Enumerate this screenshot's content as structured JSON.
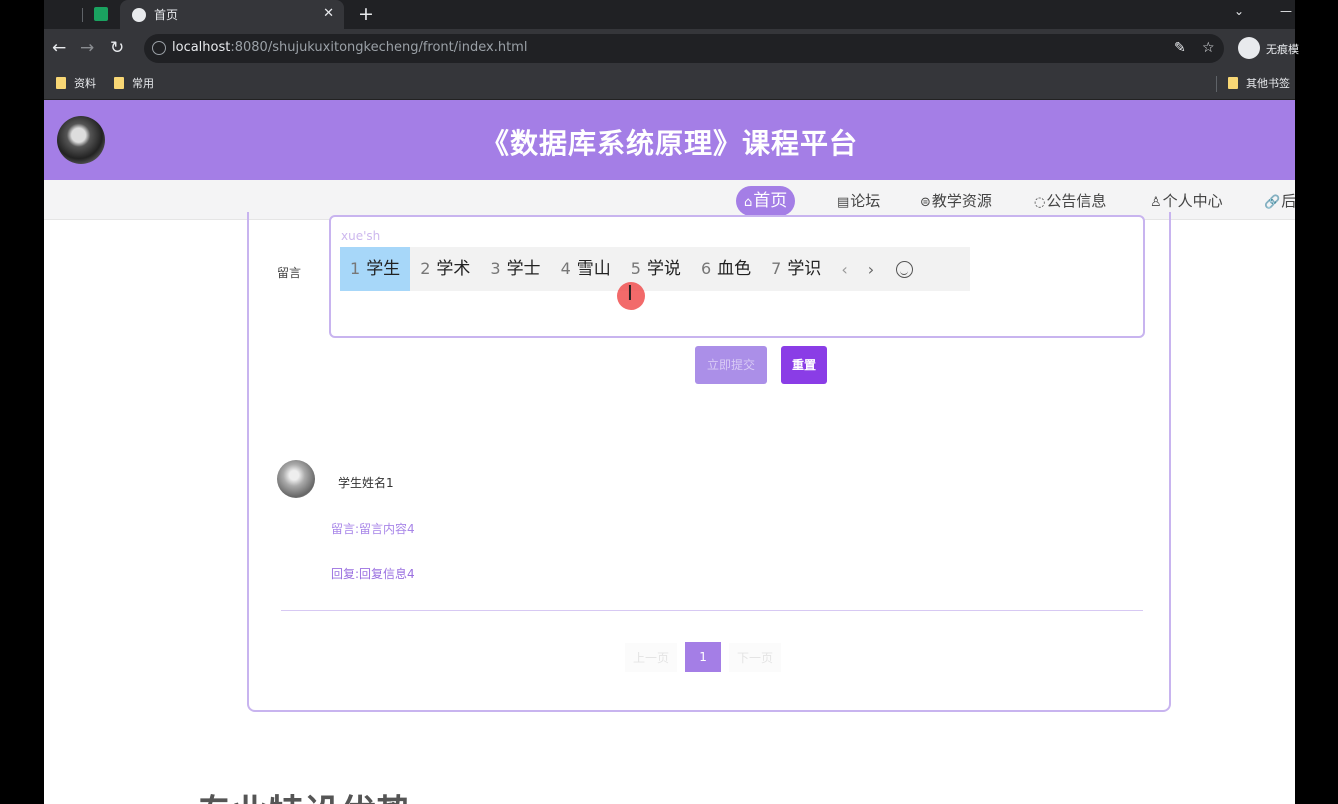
{
  "browser": {
    "tab_title": "首页",
    "url_host": "localhost",
    "url_rest": ":8080/shujukuxitongkecheng/front/index.html",
    "profile_name": "无痕模",
    "bookmarks": [
      "资料",
      "常用"
    ],
    "other_bookmarks": "其他书签"
  },
  "site": {
    "title": "《数据库系统原理》课程平台"
  },
  "nav": [
    {
      "icon": "⌂",
      "label": "首页"
    },
    {
      "icon": "▤",
      "label": "论坛"
    },
    {
      "icon": "⊜",
      "label": "教学资源"
    },
    {
      "icon": "◌",
      "label": "公告信息"
    },
    {
      "icon": "♙",
      "label": "个人中心"
    },
    {
      "icon": "🔗",
      "label": "后"
    }
  ],
  "form": {
    "label": "留言",
    "composition": "xue'sh",
    "candidates": [
      {
        "n": "1",
        "text": "学生"
      },
      {
        "n": "2",
        "text": "学术"
      },
      {
        "n": "3",
        "text": "学士"
      },
      {
        "n": "4",
        "text": "雪山"
      },
      {
        "n": "5",
        "text": "学说"
      },
      {
        "n": "6",
        "text": "血色"
      },
      {
        "n": "7",
        "text": "学识"
      }
    ],
    "prev_arrow": "‹",
    "next_arrow": "›",
    "submit_label": "立即提交",
    "reset_label": "重置"
  },
  "comment": {
    "author": "学生姓名1",
    "content": "留言:留言内容4",
    "reply": "回复:回复信息4"
  },
  "pager": {
    "prev": "上一页",
    "current": "1",
    "next": "下一页"
  },
  "section_heading": "专业特设优势"
}
